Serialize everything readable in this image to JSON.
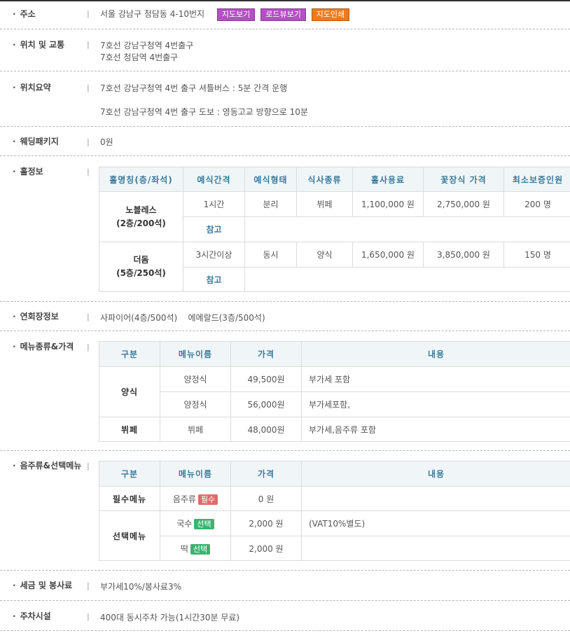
{
  "colors": {
    "map_button": "#b44fc4",
    "road_button": "#b44fc4",
    "print_button": "#f07a1a",
    "header_bg": "#f0f6f8",
    "header_text": "#3a7a9b",
    "required_badge": "#e06b6b",
    "optional_badge": "#3cb371"
  },
  "address": {
    "label": "주소",
    "value": "서울 강남구 청담동 4-10번지",
    "map_button": "지도보기",
    "road_button": "로드뷰보기",
    "print_button": "지도인쇄"
  },
  "transport": {
    "label": "위치 및 교통",
    "line1": "7호선 강남구청역 4번출구",
    "line2": "7호선 청담역 4번출구"
  },
  "summary": {
    "label": "위치요약",
    "line1": "7호선 강남구청역 4번 출구 셔틀버스 : 5분 간격 운행",
    "line2": "7호선 강남구청역 4번 출구 도보 : 영동고교 방향으로 10분"
  },
  "package": {
    "label": "웨딩패키지",
    "value": "0원"
  },
  "halls": {
    "label": "홀정보",
    "headers": [
      "홀명칭(층/좌석)",
      "예식간격",
      "예식형태",
      "식사종류",
      "홀사용료",
      "꽃장식 가격",
      "최소보증인원"
    ],
    "rows": [
      {
        "name": "노블레스",
        "floor": "(2층/200석)",
        "interval": "1시간",
        "type": "분리",
        "meal": "뷔페",
        "fee": "1,100,000 원",
        "flower": "2,750,000 원",
        "minimum": "200 명",
        "note_label": "참고",
        "note": ""
      },
      {
        "name": "더돔",
        "floor": "(5층/250석)",
        "interval": "3시간이상",
        "type": "동시",
        "meal": "양식",
        "fee": "1,650,000 원",
        "flower": "3,850,000 원",
        "minimum": "150 명",
        "note_label": "참고",
        "note": ""
      }
    ]
  },
  "banquet": {
    "label": "연회장정보",
    "value": "사파이어(4층/500석)    에메랄드(3층/500석)"
  },
  "menu": {
    "label": "메뉴종류&가격",
    "headers": [
      "구분",
      "메뉴이름",
      "가격",
      "내용"
    ],
    "rows": [
      {
        "category": "양식",
        "name": "양정식",
        "price": "49,500원",
        "desc": "부가세 포함"
      },
      {
        "category": "",
        "name": "양정식",
        "price": "56,000원",
        "desc": "부가세포함,"
      },
      {
        "category": "뷔페",
        "name": "뷔페",
        "price": "48,000원",
        "desc": "부가세,음주류 포함"
      }
    ]
  },
  "drinks": {
    "label": "음주류&선택메뉴",
    "headers": [
      "구분",
      "메뉴이름",
      "가격",
      "내용"
    ],
    "rows": [
      {
        "category": "필수메뉴",
        "name": "음주류",
        "badge": "필수",
        "price": "0 원",
        "desc": ""
      },
      {
        "category": "선택메뉴",
        "name": "국수",
        "badge": "선택",
        "price": "2,000 원",
        "desc": "(VAT10%별도)"
      },
      {
        "category": "",
        "name": "떡",
        "badge": "선택",
        "price": "2,000 원",
        "desc": ""
      }
    ]
  },
  "tax": {
    "label": "세금 및 봉사료",
    "value": "부가세10%/봉사료3%"
  },
  "parking": {
    "label": "주차시설",
    "value": "400대 동시주차 가능(1시간30분 무료)"
  }
}
